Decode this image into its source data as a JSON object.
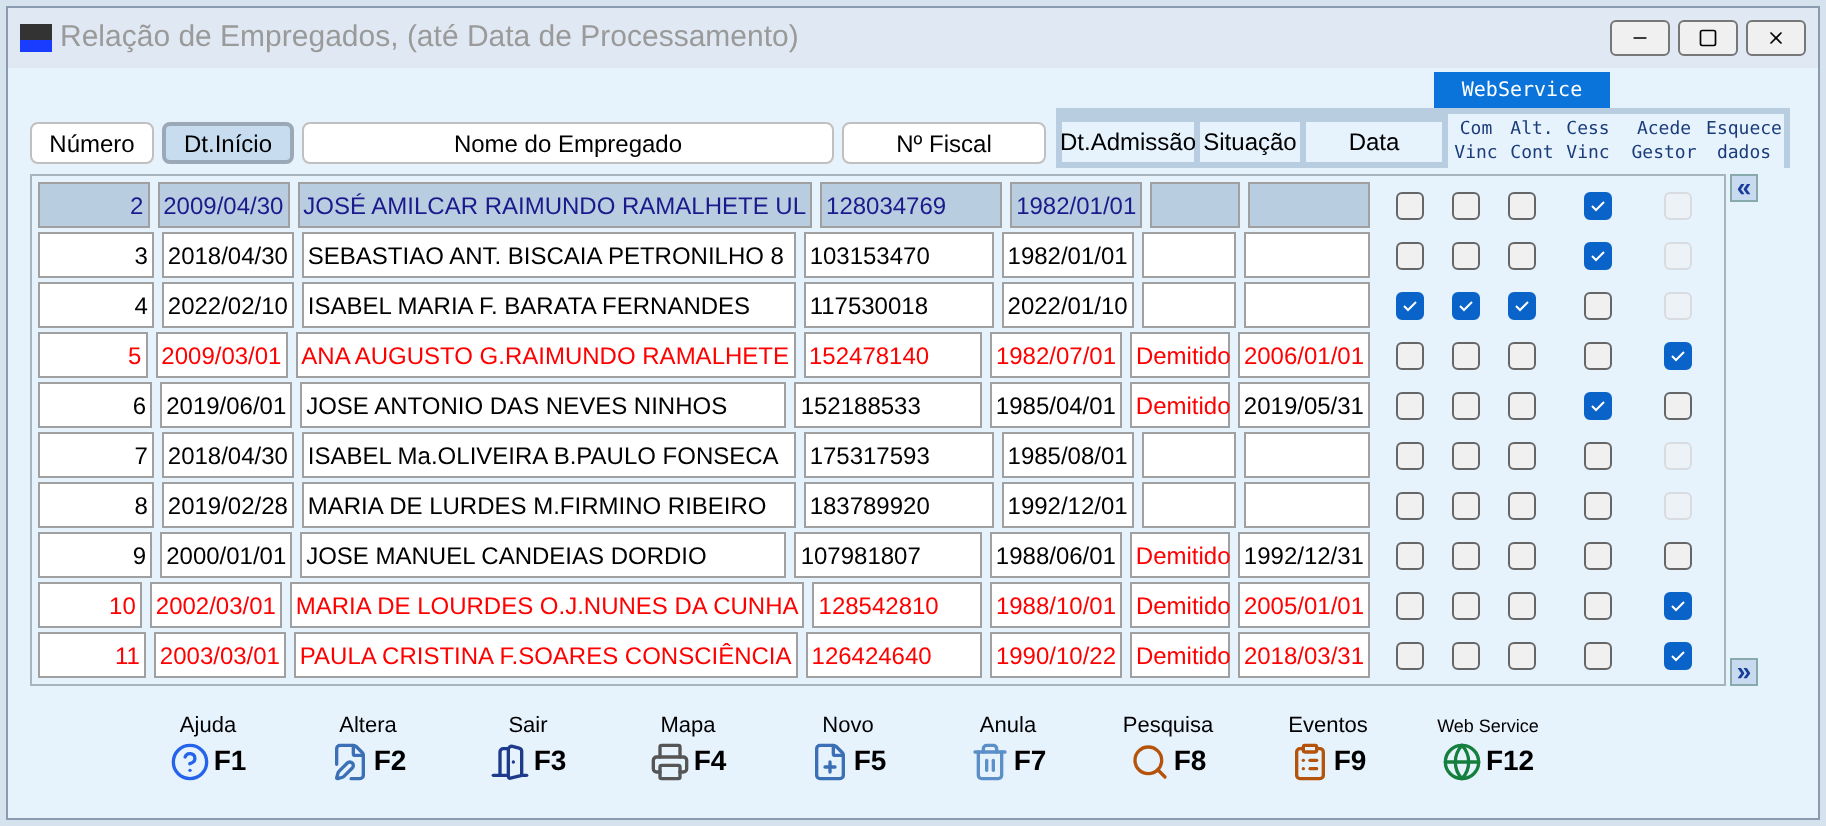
{
  "window": {
    "title": "Relação de Empregados, (até Data de Processamento)"
  },
  "columns": [
    {
      "label": "Número",
      "selected": false
    },
    {
      "label": "Dt.Início",
      "selected": true
    },
    {
      "label": "Nome do Empregado",
      "selected": false
    },
    {
      "label": "Nº Fiscal",
      "selected": false
    }
  ],
  "fixed_columns": [
    "Dt.Admissão",
    "Situação",
    "Data"
  ],
  "webservice_label": "WebService",
  "check_columns": [
    "Com\nVinc",
    "Alt.\nCont",
    "Cess\nVinc",
    "Acede\nGestor",
    "Esquece\ndados"
  ],
  "rows": [
    {
      "numero": "2",
      "inicio": "2009/04/30",
      "nome": "JOSÉ AMILCAR RAIMUNDO RAMALHETE UL",
      "fiscal": "128034769",
      "admissao": "1982/01/01",
      "situacao": "",
      "data": "",
      "annulled": false,
      "selected": true,
      "checks": [
        {
          "checked": false,
          "disabled": false
        },
        {
          "checked": false,
          "disabled": false
        },
        {
          "checked": false,
          "disabled": false
        },
        {
          "checked": true,
          "disabled": false
        },
        {
          "checked": false,
          "disabled": true
        }
      ]
    },
    {
      "numero": "3",
      "inicio": "2018/04/30",
      "nome": "SEBASTIAO ANT. BISCAIA PETRONILHO 8",
      "fiscal": "103153470",
      "admissao": "1982/01/01",
      "situacao": "",
      "data": "",
      "annulled": false,
      "selected": false,
      "checks": [
        {
          "checked": false,
          "disabled": false
        },
        {
          "checked": false,
          "disabled": false
        },
        {
          "checked": false,
          "disabled": false
        },
        {
          "checked": true,
          "disabled": false
        },
        {
          "checked": false,
          "disabled": true
        }
      ]
    },
    {
      "numero": "4",
      "inicio": "2022/02/10",
      "nome": "ISABEL MARIA F. BARATA FERNANDES",
      "fiscal": "117530018",
      "admissao": "2022/01/10",
      "situacao": "",
      "data": "",
      "annulled": false,
      "selected": false,
      "checks": [
        {
          "checked": true,
          "disabled": false
        },
        {
          "checked": true,
          "disabled": false
        },
        {
          "checked": true,
          "disabled": false
        },
        {
          "checked": false,
          "disabled": false
        },
        {
          "checked": false,
          "disabled": true
        }
      ]
    },
    {
      "numero": "5",
      "inicio": "2009/03/01",
      "nome": "ANA AUGUSTO G.RAIMUNDO RAMALHETE",
      "fiscal": "152478140",
      "admissao": "1982/07/01",
      "situacao": "Demitido",
      "data": "2006/01/01",
      "annulled": true,
      "selected": false,
      "checks": [
        {
          "checked": false,
          "disabled": false
        },
        {
          "checked": false,
          "disabled": false
        },
        {
          "checked": false,
          "disabled": false
        },
        {
          "checked": false,
          "disabled": false
        },
        {
          "checked": true,
          "disabled": false
        }
      ]
    },
    {
      "numero": "6",
      "inicio": "2019/06/01",
      "nome": "JOSE ANTONIO DAS NEVES NINHOS",
      "fiscal": "152188533",
      "admissao": "1985/04/01",
      "situacao": "Demitido",
      "data": "2019/05/31",
      "annulled": false,
      "selected": false,
      "checks": [
        {
          "checked": false,
          "disabled": false
        },
        {
          "checked": false,
          "disabled": false
        },
        {
          "checked": false,
          "disabled": false
        },
        {
          "checked": true,
          "disabled": false
        },
        {
          "checked": false,
          "disabled": false
        }
      ]
    },
    {
      "numero": "7",
      "inicio": "2018/04/30",
      "nome": "ISABEL Ma.OLIVEIRA B.PAULO FONSECA",
      "fiscal": "175317593",
      "admissao": "1985/08/01",
      "situacao": "",
      "data": "",
      "annulled": false,
      "selected": false,
      "checks": [
        {
          "checked": false,
          "disabled": false
        },
        {
          "checked": false,
          "disabled": false
        },
        {
          "checked": false,
          "disabled": false
        },
        {
          "checked": false,
          "disabled": false
        },
        {
          "checked": false,
          "disabled": true
        }
      ]
    },
    {
      "numero": "8",
      "inicio": "2019/02/28",
      "nome": "MARIA DE LURDES M.FIRMINO RIBEIRO",
      "fiscal": "183789920",
      "admissao": "1992/12/01",
      "situacao": "",
      "data": "",
      "annulled": false,
      "selected": false,
      "checks": [
        {
          "checked": false,
          "disabled": false
        },
        {
          "checked": false,
          "disabled": false
        },
        {
          "checked": false,
          "disabled": false
        },
        {
          "checked": false,
          "disabled": false
        },
        {
          "checked": false,
          "disabled": true
        }
      ]
    },
    {
      "numero": "9",
      "inicio": "2000/01/01",
      "nome": "JOSE MANUEL CANDEIAS DORDIO",
      "fiscal": "107981807",
      "admissao": "1988/06/01",
      "situacao": "Demitido",
      "data": "1992/12/31",
      "annulled": false,
      "selected": false,
      "checks": [
        {
          "checked": false,
          "disabled": false
        },
        {
          "checked": false,
          "disabled": false
        },
        {
          "checked": false,
          "disabled": false
        },
        {
          "checked": false,
          "disabled": false
        },
        {
          "checked": false,
          "disabled": false
        }
      ]
    },
    {
      "numero": "10",
      "inicio": "2002/03/01",
      "nome": "MARIA DE LOURDES O.J.NUNES DA CUNHA",
      "fiscal": "128542810",
      "admissao": "1988/10/01",
      "situacao": "Demitido",
      "data": "2005/01/01",
      "annulled": true,
      "selected": false,
      "checks": [
        {
          "checked": false,
          "disabled": false
        },
        {
          "checked": false,
          "disabled": false
        },
        {
          "checked": false,
          "disabled": false
        },
        {
          "checked": false,
          "disabled": false
        },
        {
          "checked": true,
          "disabled": false
        }
      ]
    },
    {
      "numero": "11",
      "inicio": "2003/03/01",
      "nome": "PAULA CRISTINA F.SOARES CONSCIÊNCIA",
      "fiscal": "126424640",
      "admissao": "1990/10/22",
      "situacao": "Demitido",
      "data": "2018/03/31",
      "annulled": true,
      "selected": false,
      "checks": [
        {
          "checked": false,
          "disabled": false
        },
        {
          "checked": false,
          "disabled": false
        },
        {
          "checked": false,
          "disabled": false
        },
        {
          "checked": false,
          "disabled": false
        },
        {
          "checked": true,
          "disabled": false
        }
      ]
    }
  ],
  "scroll_buttons": [
    "«",
    "»"
  ],
  "toolbar": [
    {
      "label": "Ajuda",
      "key": "F1",
      "kind": "help"
    },
    {
      "label": "Altera",
      "key": "F2",
      "kind": "edit"
    },
    {
      "label": "Sair",
      "key": "F3",
      "kind": "exit"
    },
    {
      "label": "Mapa",
      "key": "F4",
      "kind": "print"
    },
    {
      "label": "Novo",
      "key": "F5",
      "kind": "new"
    },
    {
      "label": "Anula",
      "key": "F7",
      "kind": "delete"
    },
    {
      "label": "Pesquisa",
      "key": "F8",
      "kind": "search"
    },
    {
      "label": "Eventos",
      "key": "F9",
      "kind": "events"
    },
    {
      "label": "Web Service",
      "key": "F12",
      "kind": "web"
    }
  ]
}
